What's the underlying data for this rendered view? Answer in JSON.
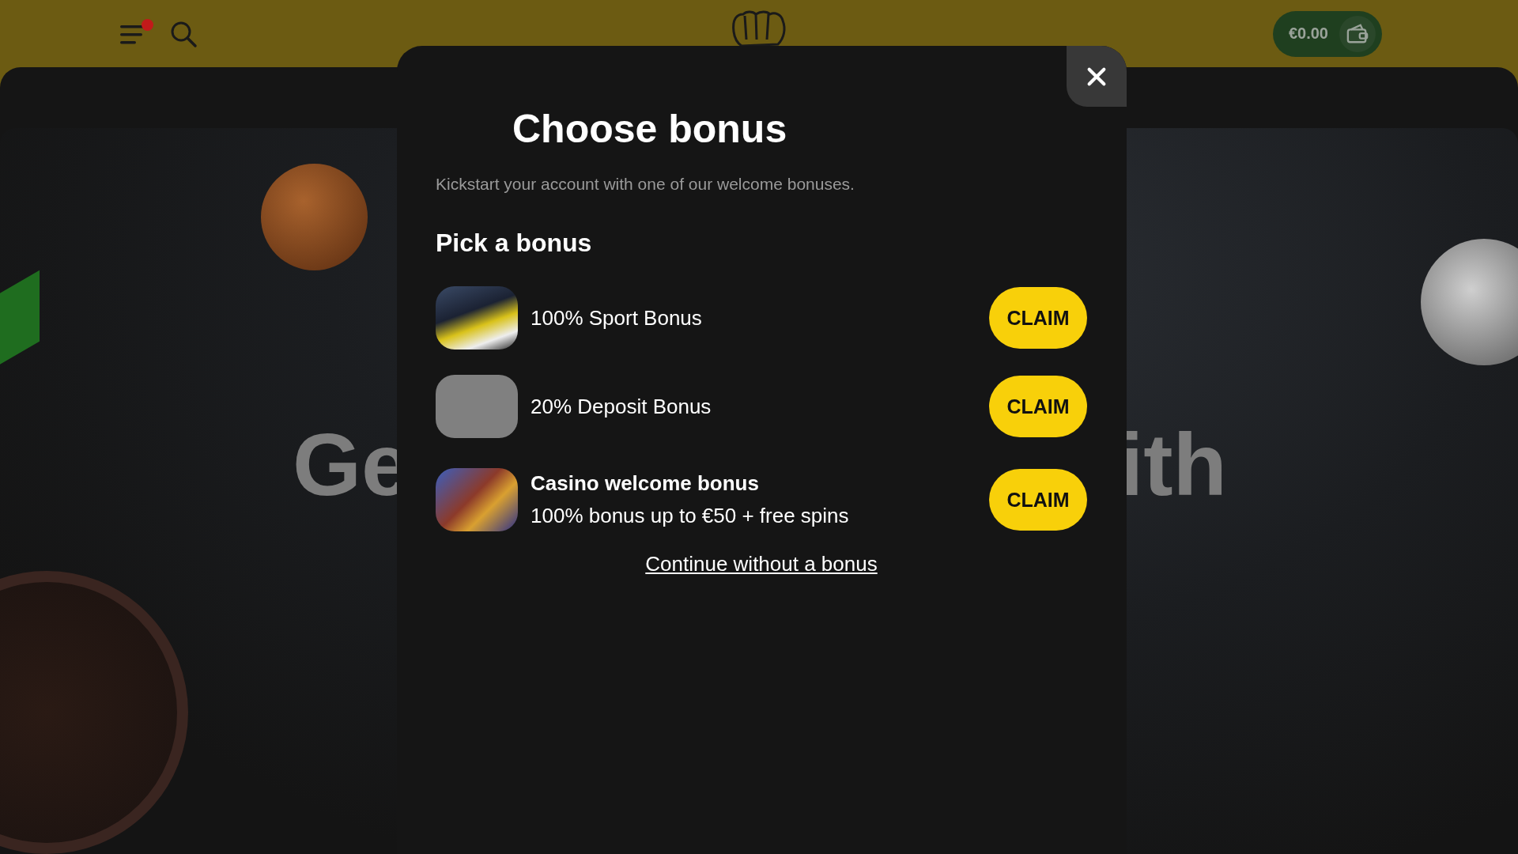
{
  "header": {
    "menu_notification": true,
    "balance": "€0.00"
  },
  "hero": {
    "text_left": "Ge",
    "text_right": "ith"
  },
  "modal": {
    "title": "Choose bonus",
    "subtitle": "Kickstart your account with one of our welcome bonuses.",
    "section_title": "Pick a bonus",
    "bonuses": [
      {
        "kind": "sport",
        "title": "100% Sport Bonus",
        "button": "CLAIM"
      },
      {
        "kind": "blank",
        "title": "20% Deposit Bonus",
        "button": "CLAIM"
      },
      {
        "kind": "casino",
        "title": "Casino welcome bonus",
        "subtitle": "100% bonus up to €50 + free spins",
        "button": "CLAIM"
      }
    ],
    "skip_link": "Continue without a bonus"
  }
}
